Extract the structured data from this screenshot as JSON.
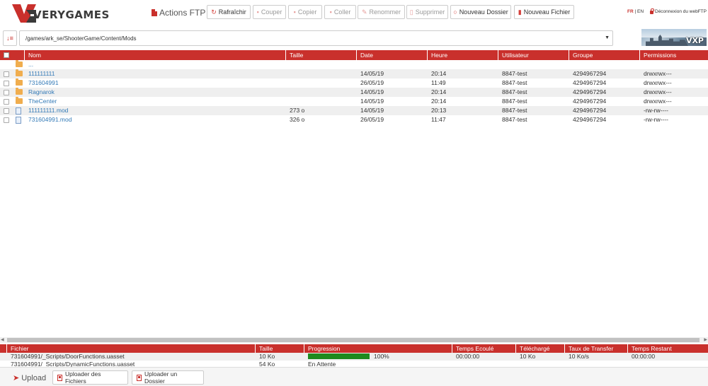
{
  "header": {
    "logo_text": "VERYGAMES",
    "actions_title": "Actions FTP",
    "toolbar": [
      {
        "label": "Rafraîchir",
        "name": "refresh-button",
        "icon": "refresh-icon",
        "state": "active"
      },
      {
        "label": "Couper",
        "name": "cut-button",
        "icon": "cut-icon",
        "state": "disabled"
      },
      {
        "label": "Copier",
        "name": "copy-button",
        "icon": "copy-icon",
        "state": "disabled"
      },
      {
        "label": "Coller",
        "name": "paste-button",
        "icon": "paste-icon",
        "state": "disabled"
      },
      {
        "label": "Renommer",
        "name": "rename-button",
        "icon": "pencil-icon",
        "state": "disabled"
      },
      {
        "label": "Supprimer",
        "name": "delete-button",
        "icon": "trash-icon",
        "state": "disabled"
      },
      {
        "label": "Nouveau Dossier",
        "name": "new-folder-button",
        "icon": "circle-icon",
        "state": "active"
      },
      {
        "label": "Nouveau Fichier",
        "name": "new-file-button",
        "icon": "file-icon",
        "state": "active"
      }
    ],
    "lang_fr": "FR",
    "lang_sep": "|",
    "lang_en": "EN",
    "logout": "Déconnexion du webFTP"
  },
  "path": {
    "current": "/games/ark_se/ShooterGame/Content/Mods",
    "banner_text": "VXP"
  },
  "file_table": {
    "columns": [
      "Nom",
      "Taille",
      "Date",
      "Heure",
      "Utilisateur",
      "Groupe",
      "Permissions"
    ],
    "parent_label": "...",
    "rows": [
      {
        "type": "folder",
        "name": "111111111",
        "size": "",
        "date": "14/05/19",
        "time": "20:14",
        "user": "8847-test",
        "group": "4294967294",
        "perms": "drwxrwx---"
      },
      {
        "type": "folder",
        "name": "731604991",
        "size": "",
        "date": "26/05/19",
        "time": "11:49",
        "user": "8847-test",
        "group": "4294967294",
        "perms": "drwxrwx---"
      },
      {
        "type": "folder",
        "name": "Ragnarok",
        "size": "",
        "date": "14/05/19",
        "time": "20:14",
        "user": "8847-test",
        "group": "4294967294",
        "perms": "drwxrwx---"
      },
      {
        "type": "folder",
        "name": "TheCenter",
        "size": "",
        "date": "14/05/19",
        "time": "20:14",
        "user": "8847-test",
        "group": "4294967294",
        "perms": "drwxrwx---"
      },
      {
        "type": "file",
        "name": "111111111.mod",
        "size": "273 o",
        "date": "14/05/19",
        "time": "20:13",
        "user": "8847-test",
        "group": "4294967294",
        "perms": "-rw-rw----"
      },
      {
        "type": "file",
        "name": "731604991.mod",
        "size": "326 o",
        "date": "26/05/19",
        "time": "11:47",
        "user": "8847-test",
        "group": "4294967294",
        "perms": "-rw-rw----"
      }
    ]
  },
  "queue": {
    "columns": [
      "Fichier",
      "Taille",
      "Progression",
      "Temps Ecoulé",
      "Téléchargé",
      "Taux de Transfer",
      "Temps Restant"
    ],
    "rows": [
      {
        "file": "731604991/_Scripts/DoorFunctions.uasset",
        "size": "10 Ko",
        "progress": 1.0,
        "progress_text": "100%",
        "elapsed": "00:00:00",
        "downloaded": "10 Ko",
        "rate": "10 Ko/s",
        "remaining": "00:00:00"
      },
      {
        "file": "731604991/_Scripts/DynamicFunctions.uasset",
        "size": "54 Ko",
        "progress": 0,
        "progress_text": "En Attente",
        "elapsed": "",
        "downloaded": "",
        "rate": "",
        "remaining": ""
      }
    ]
  },
  "footer": {
    "upload_label": "Upload",
    "upload_files": "Uploader des Fichiers",
    "upload_folder": "Uploader un Dossier"
  }
}
